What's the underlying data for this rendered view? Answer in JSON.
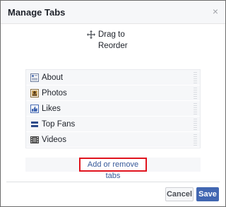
{
  "dialog": {
    "title": "Manage Tabs",
    "close_glyph": "×"
  },
  "drag": {
    "line1": "Drag to",
    "line2": "Reorder",
    "icon": "move-icon"
  },
  "tabs": [
    {
      "label": "About",
      "icon": "about-icon"
    },
    {
      "label": "Photos",
      "icon": "photos-icon"
    },
    {
      "label": "Likes",
      "icon": "likes-icon"
    },
    {
      "label": "Top Fans",
      "icon": "top-fans-icon"
    },
    {
      "label": "Videos",
      "icon": "videos-icon"
    }
  ],
  "add_remove_label": "Add or remove tabs",
  "footer": {
    "cancel_label": "Cancel",
    "save_label": "Save"
  },
  "colors": {
    "brand": "#4267b2",
    "link": "#365899",
    "highlight": "#e0141e"
  }
}
